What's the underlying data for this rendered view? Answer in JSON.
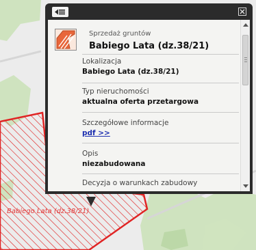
{
  "map": {
    "parcel_label": "Babiego Lata (dz.38/21)",
    "colors": {
      "background": "#ececec",
      "forest": "#cfe3bf",
      "parcel_stroke": "#e02424"
    }
  },
  "popup": {
    "header": {
      "menu_icon": "list-icon",
      "close_icon": "close-icon"
    },
    "category": "Sprzedaż gruntów",
    "title": "Babiego Lata (dz.38/21)",
    "fields": [
      {
        "label": "Lokalizacja",
        "value": "Babiego Lata (dz.38/21)"
      },
      {
        "label": "Typ nieruchomości",
        "value": "aktualna oferta przetargowa"
      },
      {
        "label": "Szczegółowe informacje",
        "value": "pdf >>"
      },
      {
        "label": "Opis",
        "value": "niezabudowana"
      },
      {
        "label": "Decyzja o warunkach zabudowy",
        "value": ""
      }
    ]
  }
}
